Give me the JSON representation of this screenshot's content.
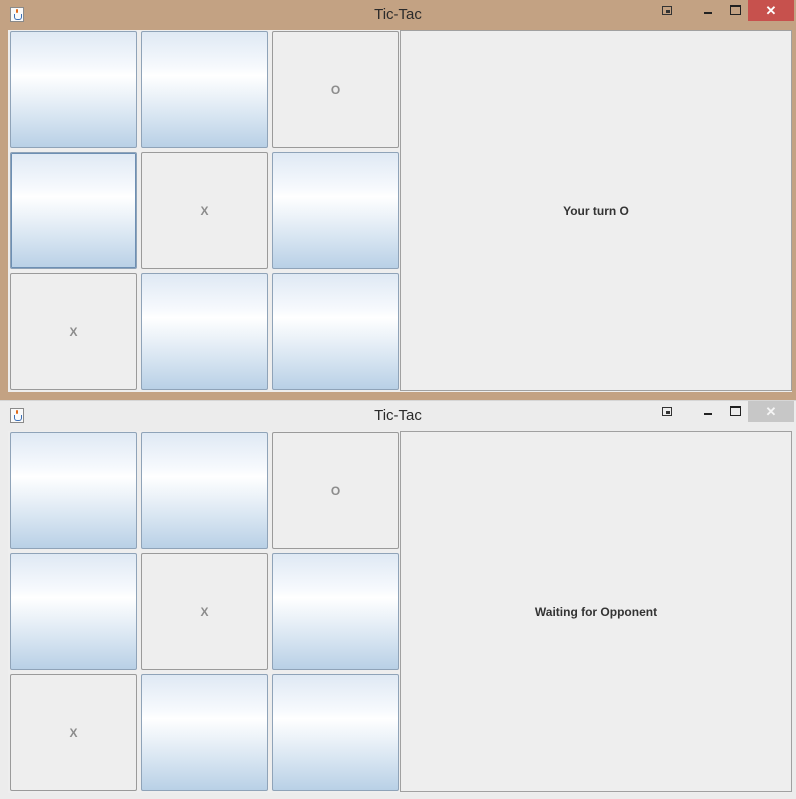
{
  "windows": [
    {
      "title": "Tic-Tac",
      "active": true,
      "board": [
        "",
        "",
        "O",
        "",
        "X",
        "",
        "X",
        "",
        ""
      ],
      "status": "Your turn O"
    },
    {
      "title": "Tic-Tac",
      "active": false,
      "board": [
        "",
        "",
        "O",
        "",
        "X",
        "",
        "X",
        "",
        ""
      ],
      "status": "Waiting for Opponent"
    }
  ],
  "icons": {
    "app": "java-cup-icon",
    "restore": "restore-icon",
    "minimize": "minimize-icon",
    "maximize": "maximize-icon",
    "close": "close-icon"
  },
  "colors": {
    "active_frame": "#c3a283",
    "inactive_frame": "#ececec",
    "close_active": "#c7514d",
    "close_inactive": "#c7c7c7"
  }
}
